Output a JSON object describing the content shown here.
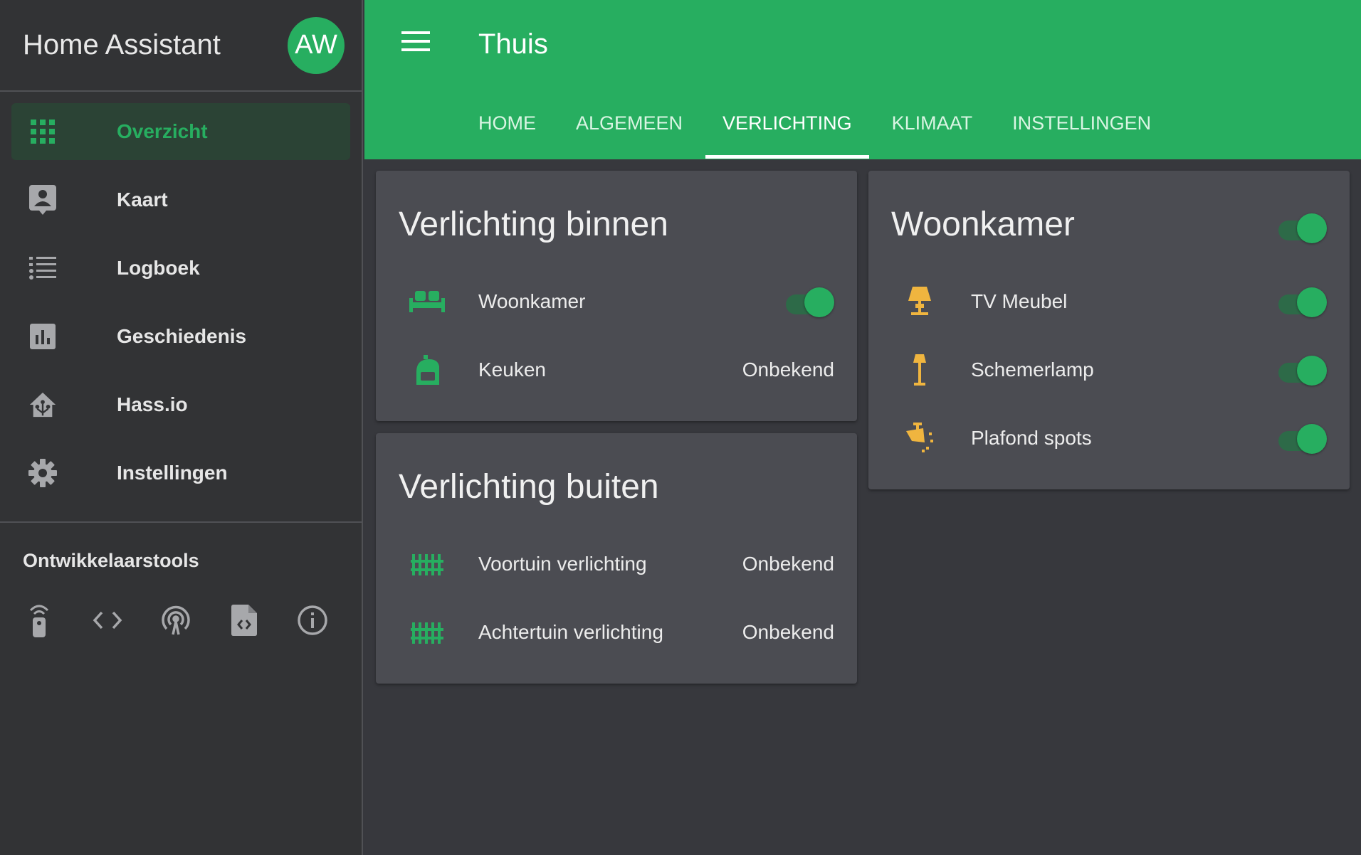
{
  "app": {
    "title": "Home Assistant",
    "avatar_initials": "AW"
  },
  "sidebar": {
    "items": [
      {
        "label": "Overzicht",
        "icon": "grid-icon",
        "active": true
      },
      {
        "label": "Kaart",
        "icon": "account-box-icon"
      },
      {
        "label": "Logboek",
        "icon": "list-icon"
      },
      {
        "label": "Geschiedenis",
        "icon": "chart-bar-icon"
      },
      {
        "label": "Hass.io",
        "icon": "hassio-icon"
      },
      {
        "label": "Instellingen",
        "icon": "gear-icon"
      }
    ],
    "dev_tools_title": "Ontwikkelaarstools",
    "dev_tools": [
      "remote-icon",
      "code-icon",
      "podcast-icon",
      "file-code-icon",
      "info-icon"
    ]
  },
  "header": {
    "title": "Thuis",
    "tabs": [
      "HOME",
      "ALGEMEEN",
      "VERLICHTING",
      "KLIMAAT",
      "INSTELLINGEN"
    ],
    "active_tab": "VERLICHTING"
  },
  "cards": {
    "binnen": {
      "title": "Verlichting binnen",
      "rows": [
        {
          "name": "Woonkamer",
          "icon": "sofa-icon",
          "toggle": true,
          "on": true
        },
        {
          "name": "Keuken",
          "icon": "stove-icon",
          "state": "Onbekend"
        }
      ]
    },
    "buiten": {
      "title": "Verlichting buiten",
      "rows": [
        {
          "name": "Voortuin verlichting",
          "icon": "fence-icon",
          "state": "Onbekend"
        },
        {
          "name": "Achtertuin verlichting",
          "icon": "fence-icon",
          "state": "Onbekend"
        }
      ]
    },
    "woonkamer": {
      "title": "Woonkamer",
      "header_toggle_on": true,
      "rows": [
        {
          "name": "TV Meubel",
          "icon": "lamp-icon",
          "toggle": true,
          "on": true
        },
        {
          "name": "Schemerlamp",
          "icon": "floor-lamp-icon",
          "toggle": true,
          "on": true
        },
        {
          "name": "Plafond spots",
          "icon": "ceiling-spot-icon",
          "toggle": true,
          "on": true
        }
      ]
    }
  },
  "colors": {
    "accent": "#27ae60",
    "sidebar_bg": "#323335",
    "card_bg": "#4b4c52",
    "page_bg": "#37383d",
    "light_on": "#f0b53f"
  }
}
